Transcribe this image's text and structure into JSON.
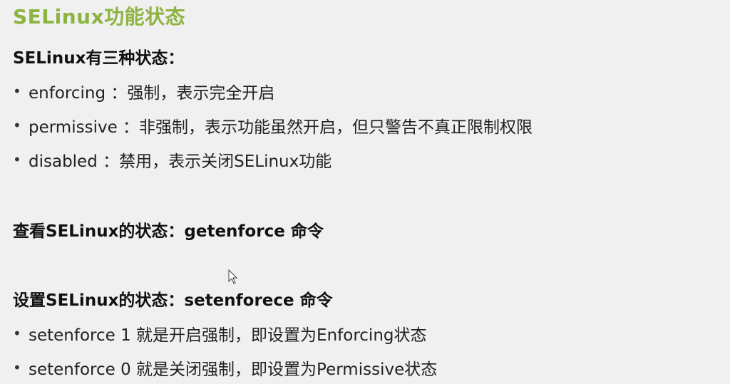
{
  "title": "SELinux功能状态",
  "section1": {
    "heading": "SELinux有三种状态：",
    "items": [
      "enforcing ：强制，表示完全开启",
      "permissive ：非强制，表示功能虽然开启，但只警告不真正限制权限",
      "disabled ：禁用，表示关闭SELinux功能"
    ]
  },
  "section2": {
    "heading": "查看SELinux的状态：getenforce 命令"
  },
  "section3": {
    "heading": "设置SELinux的状态：setenforece 命令",
    "items": [
      "setenforce 1 就是开启强制，即设置为Enforcing状态",
      "setenforce 0 就是关闭强制，即设置为Permissive状态"
    ]
  },
  "bullet_symbol": "•",
  "colors": {
    "title": "#8db441",
    "background": "#f0f0f0"
  },
  "icons": {
    "cursor": "mouse-pointer-icon"
  }
}
